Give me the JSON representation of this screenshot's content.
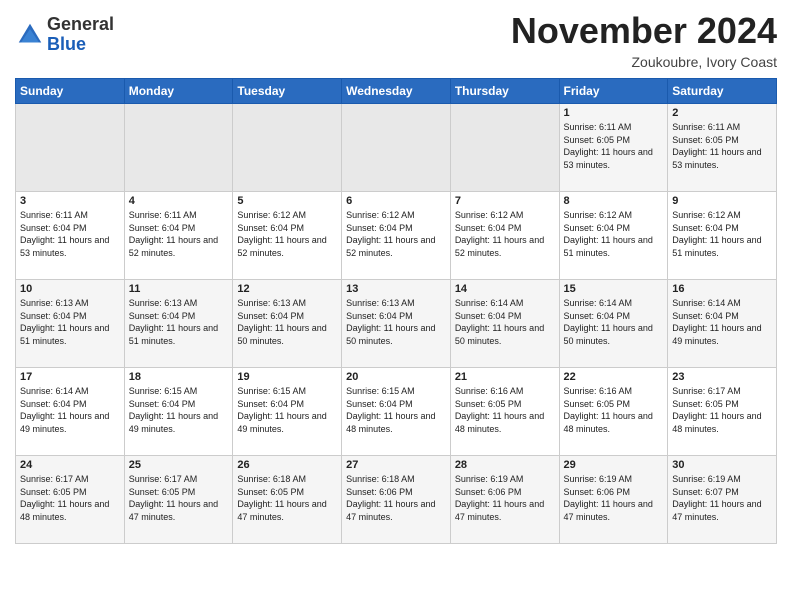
{
  "header": {
    "logo_general": "General",
    "logo_blue": "Blue",
    "month": "November 2024",
    "location": "Zoukoubre, Ivory Coast"
  },
  "weekdays": [
    "Sunday",
    "Monday",
    "Tuesday",
    "Wednesday",
    "Thursday",
    "Friday",
    "Saturday"
  ],
  "weeks": [
    [
      {
        "day": "",
        "empty": true
      },
      {
        "day": "",
        "empty": true
      },
      {
        "day": "",
        "empty": true
      },
      {
        "day": "",
        "empty": true
      },
      {
        "day": "",
        "empty": true
      },
      {
        "day": "1",
        "sunrise": "6:11 AM",
        "sunset": "6:05 PM",
        "daylight": "11 hours and 53 minutes."
      },
      {
        "day": "2",
        "sunrise": "6:11 AM",
        "sunset": "6:05 PM",
        "daylight": "11 hours and 53 minutes."
      }
    ],
    [
      {
        "day": "3",
        "sunrise": "6:11 AM",
        "sunset": "6:04 PM",
        "daylight": "11 hours and 53 minutes."
      },
      {
        "day": "4",
        "sunrise": "6:11 AM",
        "sunset": "6:04 PM",
        "daylight": "11 hours and 52 minutes."
      },
      {
        "day": "5",
        "sunrise": "6:12 AM",
        "sunset": "6:04 PM",
        "daylight": "11 hours and 52 minutes."
      },
      {
        "day": "6",
        "sunrise": "6:12 AM",
        "sunset": "6:04 PM",
        "daylight": "11 hours and 52 minutes."
      },
      {
        "day": "7",
        "sunrise": "6:12 AM",
        "sunset": "6:04 PM",
        "daylight": "11 hours and 52 minutes."
      },
      {
        "day": "8",
        "sunrise": "6:12 AM",
        "sunset": "6:04 PM",
        "daylight": "11 hours and 51 minutes."
      },
      {
        "day": "9",
        "sunrise": "6:12 AM",
        "sunset": "6:04 PM",
        "daylight": "11 hours and 51 minutes."
      }
    ],
    [
      {
        "day": "10",
        "sunrise": "6:13 AM",
        "sunset": "6:04 PM",
        "daylight": "11 hours and 51 minutes."
      },
      {
        "day": "11",
        "sunrise": "6:13 AM",
        "sunset": "6:04 PM",
        "daylight": "11 hours and 51 minutes."
      },
      {
        "day": "12",
        "sunrise": "6:13 AM",
        "sunset": "6:04 PM",
        "daylight": "11 hours and 50 minutes."
      },
      {
        "day": "13",
        "sunrise": "6:13 AM",
        "sunset": "6:04 PM",
        "daylight": "11 hours and 50 minutes."
      },
      {
        "day": "14",
        "sunrise": "6:14 AM",
        "sunset": "6:04 PM",
        "daylight": "11 hours and 50 minutes."
      },
      {
        "day": "15",
        "sunrise": "6:14 AM",
        "sunset": "6:04 PM",
        "daylight": "11 hours and 50 minutes."
      },
      {
        "day": "16",
        "sunrise": "6:14 AM",
        "sunset": "6:04 PM",
        "daylight": "11 hours and 49 minutes."
      }
    ],
    [
      {
        "day": "17",
        "sunrise": "6:14 AM",
        "sunset": "6:04 PM",
        "daylight": "11 hours and 49 minutes."
      },
      {
        "day": "18",
        "sunrise": "6:15 AM",
        "sunset": "6:04 PM",
        "daylight": "11 hours and 49 minutes."
      },
      {
        "day": "19",
        "sunrise": "6:15 AM",
        "sunset": "6:04 PM",
        "daylight": "11 hours and 49 minutes."
      },
      {
        "day": "20",
        "sunrise": "6:15 AM",
        "sunset": "6:04 PM",
        "daylight": "11 hours and 48 minutes."
      },
      {
        "day": "21",
        "sunrise": "6:16 AM",
        "sunset": "6:05 PM",
        "daylight": "11 hours and 48 minutes."
      },
      {
        "day": "22",
        "sunrise": "6:16 AM",
        "sunset": "6:05 PM",
        "daylight": "11 hours and 48 minutes."
      },
      {
        "day": "23",
        "sunrise": "6:17 AM",
        "sunset": "6:05 PM",
        "daylight": "11 hours and 48 minutes."
      }
    ],
    [
      {
        "day": "24",
        "sunrise": "6:17 AM",
        "sunset": "6:05 PM",
        "daylight": "11 hours and 48 minutes."
      },
      {
        "day": "25",
        "sunrise": "6:17 AM",
        "sunset": "6:05 PM",
        "daylight": "11 hours and 47 minutes."
      },
      {
        "day": "26",
        "sunrise": "6:18 AM",
        "sunset": "6:05 PM",
        "daylight": "11 hours and 47 minutes."
      },
      {
        "day": "27",
        "sunrise": "6:18 AM",
        "sunset": "6:06 PM",
        "daylight": "11 hours and 47 minutes."
      },
      {
        "day": "28",
        "sunrise": "6:19 AM",
        "sunset": "6:06 PM",
        "daylight": "11 hours and 47 minutes."
      },
      {
        "day": "29",
        "sunrise": "6:19 AM",
        "sunset": "6:06 PM",
        "daylight": "11 hours and 47 minutes."
      },
      {
        "day": "30",
        "sunrise": "6:19 AM",
        "sunset": "6:07 PM",
        "daylight": "11 hours and 47 minutes."
      }
    ]
  ]
}
